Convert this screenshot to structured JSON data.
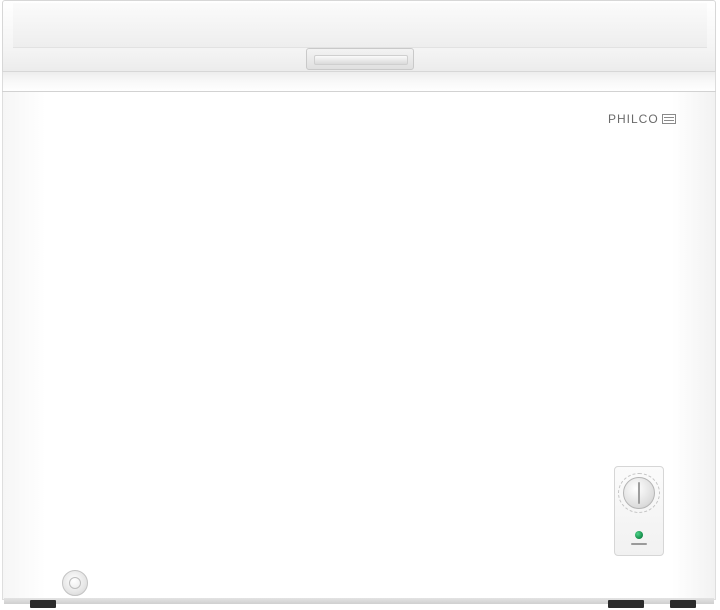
{
  "product": {
    "brand": "PHILCO",
    "logo_emblem": "grill-emblem-icon",
    "colors": {
      "body": "#ffffff",
      "indicator_led": "#1fa85c",
      "feet": "#2b2b2b"
    }
  }
}
